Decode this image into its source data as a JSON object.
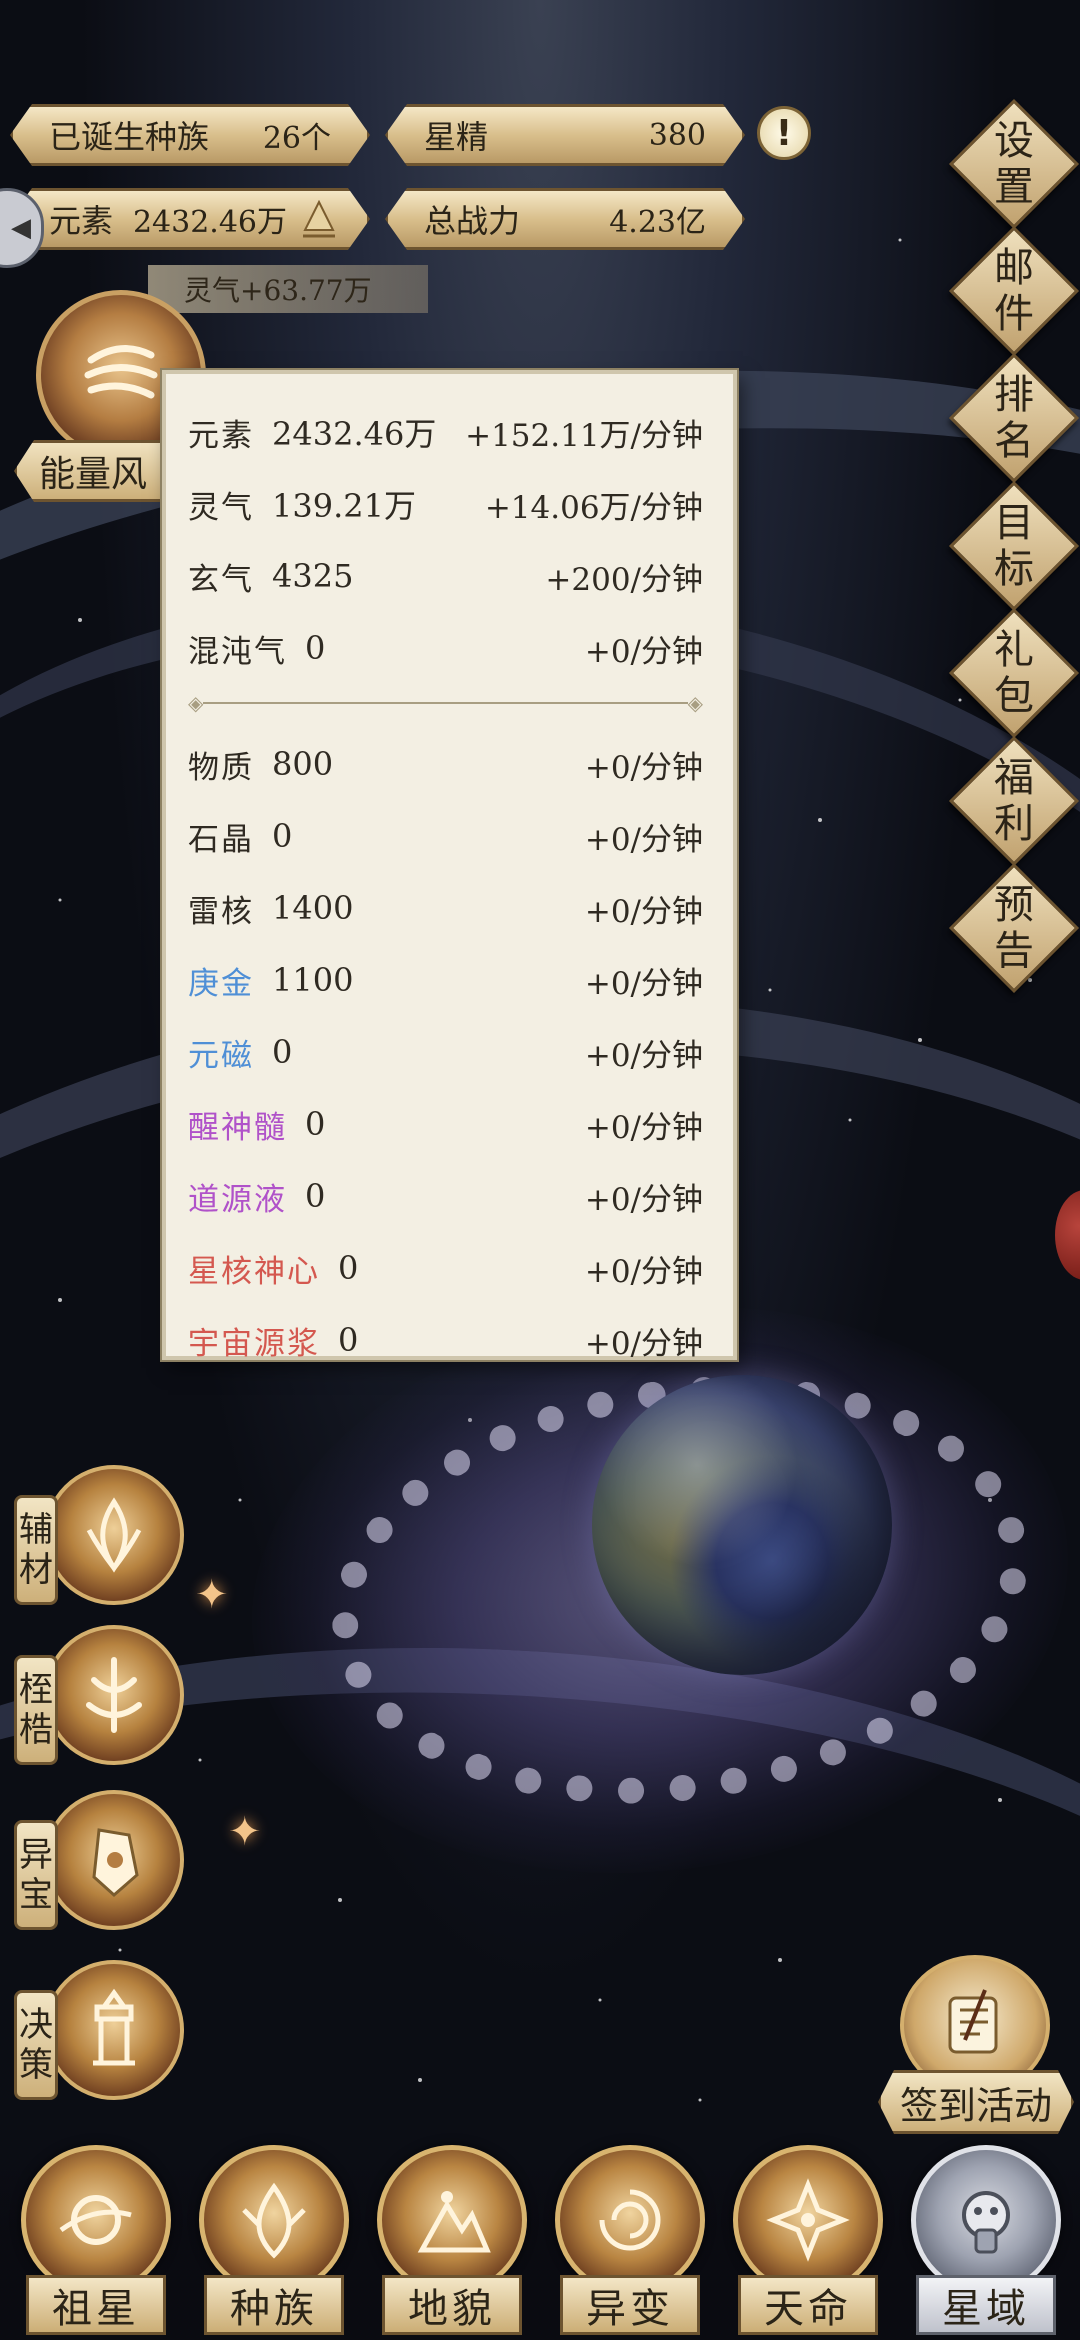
{
  "top_bar": {
    "races_label": "已诞生种族",
    "races_value": "26个",
    "star_essence_label": "星精",
    "star_essence_value": "380",
    "element_label": "元素",
    "element_value": "2432.46万",
    "power_label": "总战力",
    "power_value": "4.23亿",
    "warn_glyph": "!"
  },
  "lingqi_tip": "灵气+63.77万",
  "energy_label": "能量风",
  "popup": {
    "rows_top": [
      {
        "name": "元素",
        "value": "2432.46万",
        "rate": "+152.11万/分钟",
        "color": "#2f2a22"
      },
      {
        "name": "灵气",
        "value": "139.21万",
        "rate": "+14.06万/分钟",
        "color": "#2f2a22"
      },
      {
        "name": "玄气",
        "value": "4325",
        "rate": "+200/分钟",
        "color": "#2f2a22"
      },
      {
        "name": "混沌气",
        "value": "0",
        "rate": "+0/分钟",
        "color": "#2f2a22"
      }
    ],
    "rows_bottom": [
      {
        "name": "物质",
        "value": "800",
        "rate": "+0/分钟",
        "color": "#2f2a22"
      },
      {
        "name": "石晶",
        "value": "0",
        "rate": "+0/分钟",
        "color": "#2f2a22"
      },
      {
        "name": "雷核",
        "value": "1400",
        "rate": "+0/分钟",
        "color": "#2f2a22"
      },
      {
        "name": "庚金",
        "value": "1100",
        "rate": "+0/分钟",
        "color": "#4f8fd6"
      },
      {
        "name": "元磁",
        "value": "0",
        "rate": "+0/分钟",
        "color": "#4f8fd6"
      },
      {
        "name": "醒神髓",
        "value": "0",
        "rate": "+0/分钟",
        "color": "#b052c9"
      },
      {
        "name": "道源液",
        "value": "0",
        "rate": "+0/分钟",
        "color": "#b052c9"
      },
      {
        "name": "星核神心",
        "value": "0",
        "rate": "+0/分钟",
        "color": "#d4584f"
      },
      {
        "name": "宇宙源浆",
        "value": "0",
        "rate": "+0/分钟",
        "color": "#d4584f"
      }
    ]
  },
  "right_menu": [
    {
      "name": "settings",
      "chars": [
        "设",
        "置"
      ]
    },
    {
      "name": "mail",
      "chars": [
        "邮",
        "件"
      ]
    },
    {
      "name": "ranking",
      "chars": [
        "排",
        "名"
      ]
    },
    {
      "name": "goal",
      "chars": [
        "目",
        "标"
      ]
    },
    {
      "name": "gift-pack",
      "chars": [
        "礼",
        "包"
      ]
    },
    {
      "name": "welfare",
      "chars": [
        "福",
        "利"
      ]
    },
    {
      "name": "preview",
      "chars": [
        "预",
        "告"
      ]
    }
  ],
  "left_menu": [
    {
      "name": "auxiliary-material",
      "chars": [
        "辅",
        "材"
      ]
    },
    {
      "name": "shackles",
      "chars": [
        "桎",
        "梏"
      ]
    },
    {
      "name": "treasure",
      "chars": [
        "异",
        "宝"
      ]
    },
    {
      "name": "decision",
      "chars": [
        "决",
        "策"
      ]
    }
  ],
  "checkin_label": "签到活动",
  "bottom_nav": [
    {
      "name": "ancestor-star",
      "label": "祖星",
      "active": false
    },
    {
      "name": "race",
      "label": "种族",
      "active": false
    },
    {
      "name": "terrain",
      "label": "地貌",
      "active": false
    },
    {
      "name": "mutation",
      "label": "异变",
      "active": false
    },
    {
      "name": "destiny",
      "label": "天命",
      "active": false
    },
    {
      "name": "star-domain",
      "label": "星域",
      "active": true
    }
  ],
  "colors": {
    "gold": "#d8b46f",
    "panel": "#f3efe3",
    "blue_resource": "#4f8fd6",
    "purple_resource": "#b052c9",
    "red_resource": "#d4584f"
  }
}
